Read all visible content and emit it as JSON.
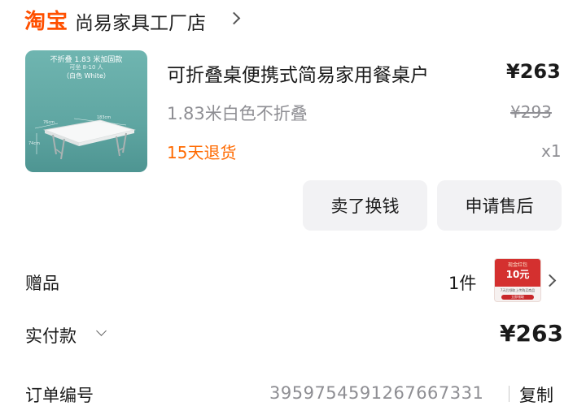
{
  "header": {
    "logo": "淘宝",
    "shop_name": "尚易家具工厂店"
  },
  "product": {
    "image": {
      "line1": "不折叠 1.83 米加固款",
      "line2": "可坐 8-10 人",
      "line3": "（白色 White）",
      "dim_a": "76cm",
      "dim_b": "183cm",
      "dim_c": "74cm"
    },
    "title": "可折叠桌便携式简易家用餐桌户",
    "price": "¥263",
    "sku": "1.83米白色不折叠",
    "original_price": "¥293",
    "refund_policy": "15天退货",
    "quantity": "x1"
  },
  "actions": {
    "sell_label": "卖了换钱",
    "after_sales_label": "申请售后"
  },
  "gift": {
    "label": "赠品",
    "count": "1件",
    "coupon": {
      "title": "现金红包",
      "amount": "10元",
      "desc": "7天后领取上传购买商品",
      "tag": "立即领取"
    }
  },
  "payment": {
    "label": "实付款",
    "amount": "¥263"
  },
  "order": {
    "label": "订单编号",
    "number": "3959754591267667331",
    "copy_label": "复制"
  },
  "colors": {
    "brand": "#ff5000",
    "refund": "#ff6a00",
    "muted": "#8e8e93",
    "button_bg": "#f2f2f4",
    "coupon_red": "#d4302f"
  }
}
